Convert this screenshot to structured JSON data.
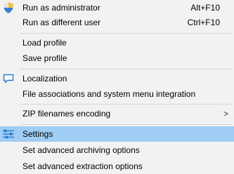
{
  "menu": {
    "items": [
      {
        "label": "Run as administrator",
        "shortcut": "Alt+F10",
        "icon": "shield-icon"
      },
      {
        "label": "Run as different user",
        "shortcut": "Ctrl+F10"
      },
      {
        "label": "Load profile"
      },
      {
        "label": "Save profile"
      },
      {
        "label": "Localization",
        "icon": "chat-bubble-icon"
      },
      {
        "label": "File associations and system menu integration"
      },
      {
        "label": "ZIP filenames encoding",
        "submenu_arrow": ">"
      },
      {
        "label": "Settings",
        "icon": "settings-sliders-icon",
        "highlighted": true
      },
      {
        "label": "Set advanced archiving options"
      },
      {
        "label": "Set advanced extraction options"
      }
    ]
  },
  "colors": {
    "highlight": "#9fcdf3",
    "menu_background": "#f2f2f2",
    "separator": "#d7d7d7",
    "icon_blue": "#2a7bd1"
  }
}
